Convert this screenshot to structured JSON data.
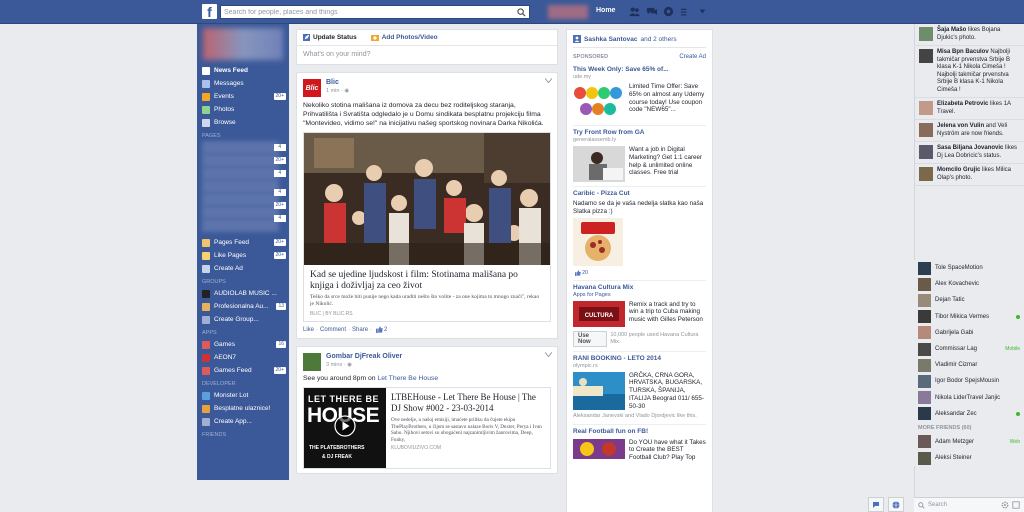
{
  "topbar": {
    "search_placeholder": "Search for people, places and things",
    "home": "Home"
  },
  "left_nav": {
    "favorites": [
      {
        "label": "News Feed",
        "count": ""
      },
      {
        "label": "Messages",
        "count": ""
      },
      {
        "label": "Events",
        "count": "20+"
      },
      {
        "label": "Photos",
        "count": ""
      },
      {
        "label": "Browse",
        "count": ""
      }
    ],
    "pages_header": "PAGES",
    "pages_counts": [
      "4",
      "20+",
      "4",
      "",
      "4",
      "20+",
      "4"
    ],
    "pages_links": [
      {
        "label": "Pages Feed",
        "count": "20+"
      },
      {
        "label": "Like Pages",
        "count": "20+"
      },
      {
        "label": "Create Ad",
        "count": ""
      }
    ],
    "groups_header": "GROUPS",
    "groups": [
      {
        "label": "AUDIOLAB MUSIC ...",
        "count": ""
      },
      {
        "label": "Profesionalna Au...",
        "count": "13"
      },
      {
        "label": "Create Group...",
        "count": ""
      }
    ],
    "apps_header": "APPS",
    "apps": [
      {
        "label": "Games",
        "count": "16"
      },
      {
        "label": "AEON7",
        "count": ""
      },
      {
        "label": "Games Feed",
        "count": "20+"
      }
    ],
    "developer_header": "DEVELOPER",
    "developer": [
      {
        "label": "Monster Lot"
      },
      {
        "label": "Besplatne ulaznice!"
      },
      {
        "label": "Create App..."
      }
    ],
    "friends_header": "FRIENDS"
  },
  "composer": {
    "update_status": "Update Status",
    "add_photos": "Add Photos/Video",
    "placeholder": "What's on your mind?"
  },
  "post1": {
    "author": "Blic",
    "time": "1 min",
    "text": "Nekoliko stotina mališana iz domova za decu bez roditeljskog staranja, Prihvatilišta i Svratišta odgledalo je u Domu sindikata besplatnu projekciju filma \"Montevideo, vidimo se!\" na inicijativu našeg sportskog novinara Darka Nikolića.",
    "link_title": "Kad se ujedine ljudskost i film: Stotinama mališana po knjiga i doživljaj za ceo život",
    "link_desc": "Teško da srce može biti punije nego kada uraditi nešto što volite - za one kojima to mnogo znači\", rekao je Nikolić.",
    "link_source": "BLIC   |   BY BLIC.RS",
    "like": "Like",
    "comment": "Comment",
    "share": "Share",
    "likes": "2"
  },
  "post2": {
    "author": "Gombar DjFreak Oliver",
    "time": "3 mins",
    "text_prefix": "See you around 8pm on ",
    "text_link": "Let There Be House",
    "img_top": "LET THERE BE",
    "img_big": "HOUSE",
    "img_sub": "THE PLATEBROTHERS",
    "img_sub2": "& DJ FREAK",
    "link_title": "LTBEHouse - Let There Be House | The DJ Show #002 - 23-03-2014",
    "link_desc": "Ove nedelje, u našoj emisiji, imaćete priliku da čujete ekipu ThePlayBrothers, u čijem se sastavu nalaze Boris V, Dexter, Perya i Ivan Sabo. Njihovi setovi su obogaćeni najzanimljivim žanrovima, Deep, Funky,",
    "link_source": "KLUBOVIUZIVO.COM"
  },
  "right_column": {
    "friends_name": "Sashka Santovac",
    "friends_others": "and 2 others",
    "sponsored": "SPONSORED",
    "create_ad": "Create Ad",
    "ads": [
      {
        "title": "This Week Only: Save 65% of...",
        "domain": "ude.my",
        "text": "Limited Time Offer: Save 65% on almost any Udemy course today! Use coupon code \"NEW65\"..."
      },
      {
        "title": "Try Front Row from GA",
        "domain": "generalassemb.ly",
        "text": "Want a job in Digital Marketing? Get 1:1 career help & unlimited online classes. Free trial"
      },
      {
        "title": "Caribic - Pizza Cut",
        "domain": "",
        "text": "Nadamo se da je vaša nedelja slatka kao naša Slatka pizza :)",
        "likes": "20"
      },
      {
        "title": "Havana Cultura Mix",
        "domain": "Apps for Pages",
        "text": "Remix a track and try to win a trip to Cuba making music with Gilles Peterson",
        "button": "Use Now",
        "note": "10,000 people used Havana Cultura Mix."
      },
      {
        "title": "RANI BOOKING - LETO 2014",
        "domain": "olympic.rs",
        "text": "GRČKA, CRNA GORA, HRVATSKA, BUGARSKA, TURSKA, ŠPANIJA, ITALIJA Beograd 011/ 655-50-30",
        "note": "Aleksandar Janevski and Vlado Djordjevic like this."
      },
      {
        "title": "Real Football fun on FB!",
        "domain": "",
        "text": "Do YOU have what it Takes to Create the BEST Football Club? Play Top"
      }
    ]
  },
  "ticker": [
    {
      "name": "Šaja Mašo",
      "rest": "likes Bojana Djukic's photo."
    },
    {
      "name": "Misa Bpn Baculov",
      "rest": "Najbolji takmičar prvenstva Srbije B klasa K-1 Nikola Cimeša ! Najbolji takmičar prvenstva Srbije B klasa K-1 Nikola Cimeša !"
    },
    {
      "name": "Elizabeta Petrovic",
      "rest": "likes 1A Travel."
    },
    {
      "name": "Jelena von Vulin",
      "rest": "and Veli Nyström are now friends."
    },
    {
      "name": "Sasa Biljana Jovanovic",
      "rest": "likes Dj Lea Dobricic's status."
    },
    {
      "name": "Momcilo Grujic",
      "rest": "likes Milica Olap's photo."
    }
  ],
  "chat": {
    "online": [
      {
        "name": "Tole SpaceMotion",
        "status": ""
      },
      {
        "name": "Alex Kovachevic",
        "status": ""
      },
      {
        "name": "Dejan Tatic",
        "status": ""
      },
      {
        "name": "Tibor Mikica Vermes",
        "status": "Web"
      },
      {
        "name": "Gabrijela Gabi",
        "status": ""
      },
      {
        "name": "Commissar Lag",
        "status": "Mobile"
      },
      {
        "name": "Vladimir Cizmar",
        "status": ""
      },
      {
        "name": "Igor Bodor SpejsMousin",
        "status": ""
      },
      {
        "name": "Nikola LiderTravel Janjic",
        "status": ""
      },
      {
        "name": "Aleksandar Zec",
        "status": "Web"
      }
    ],
    "more_friends": "MORE FRIENDS (60)",
    "more": [
      {
        "name": "Adam Metzger",
        "status": "Web"
      },
      {
        "name": "Aleksi Steiner",
        "status": ""
      }
    ],
    "search_label": "Search"
  }
}
